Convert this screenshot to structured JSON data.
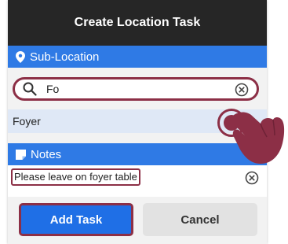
{
  "header": {
    "title": "Create Location Task"
  },
  "sub_location": {
    "label": "Sub-Location",
    "search_value": "Fo",
    "result": "Foyer"
  },
  "notes": {
    "label": "Notes",
    "value": "Please leave on foyer table"
  },
  "buttons": {
    "add": "Add Task",
    "cancel": "Cancel"
  },
  "colors": {
    "accent": "#2f7ae5",
    "highlight": "#8c2f46",
    "primary_button": "#1f6fe6"
  }
}
